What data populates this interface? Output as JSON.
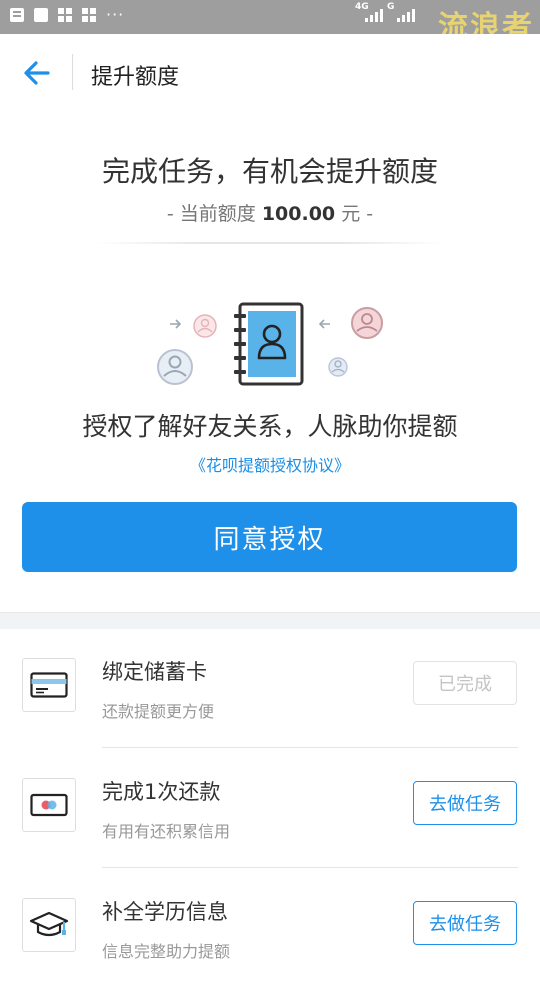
{
  "status_bar": {
    "network_label": "4G",
    "network_label_2": "G",
    "watermark": "流浪者"
  },
  "nav": {
    "title": "提升额度"
  },
  "hero": {
    "title": "完成任务，有机会提升额度",
    "quota_prefix": "- 当前额度",
    "quota_amount": "100.00",
    "quota_suffix": "元 -"
  },
  "authorization": {
    "title": "授权了解好友关系，人脉助你提额",
    "agreement_link": "《花呗提额授权协议》",
    "agree_button": "同意授权"
  },
  "tasks": [
    {
      "title": "绑定储蓄卡",
      "subtitle": "还款提额更方便",
      "button": "已完成",
      "status": "done",
      "icon": "bank-card-icon"
    },
    {
      "title": "完成1次还款",
      "subtitle": "有用有还积累信用",
      "button": "去做任务",
      "status": "todo",
      "icon": "repayment-card-icon"
    },
    {
      "title": "补全学历信息",
      "subtitle": "信息完整助力提额",
      "button": "去做任务",
      "status": "todo",
      "icon": "graduation-cap-icon"
    }
  ],
  "colors": {
    "accent": "#1e90ea",
    "status_bar": "#9e9e9e"
  }
}
